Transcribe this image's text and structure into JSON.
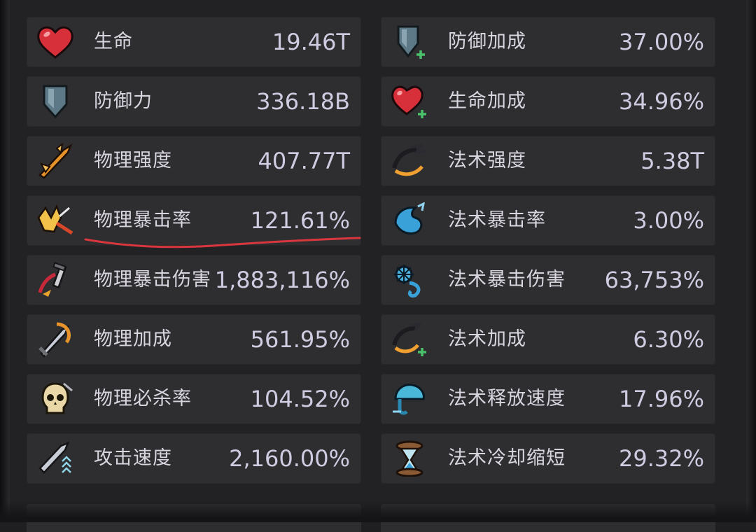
{
  "stats_left": [
    {
      "icon": "heart-icon",
      "label": "生命",
      "value": "19.46T"
    },
    {
      "icon": "shield-icon",
      "label": "防御力",
      "value": "336.18B"
    },
    {
      "icon": "physical-strike-icon",
      "label": "物理强度",
      "value": "407.77T"
    },
    {
      "icon": "physical-crit-icon",
      "label": "物理暴击率",
      "value": "121.61%"
    },
    {
      "icon": "physical-crit-damage-icon",
      "label": "物理暴击伤害",
      "value": "1,883,116%"
    },
    {
      "icon": "sword-bonus-icon",
      "label": "物理加成",
      "value": "561.95%"
    },
    {
      "icon": "skull-icon",
      "label": "物理必杀率",
      "value": "104.52%"
    },
    {
      "icon": "attack-speed-icon",
      "label": "攻击速度",
      "value": "2,160.00%"
    }
  ],
  "stats_right": [
    {
      "icon": "shield-plus-icon",
      "label": "防御加成",
      "value": "37.00%"
    },
    {
      "icon": "heart-plus-icon",
      "label": "生命加成",
      "value": "34.96%"
    },
    {
      "icon": "magic-claw-icon",
      "label": "法术强度",
      "value": "5.38T"
    },
    {
      "icon": "magic-crit-icon",
      "label": "法术暴击率",
      "value": "3.00%"
    },
    {
      "icon": "magic-crit-damage-icon",
      "label": "法术暴击伤害",
      "value": "63,753%"
    },
    {
      "icon": "magic-bonus-icon",
      "label": "法术加成",
      "value": "6.30%"
    },
    {
      "icon": "cast-speed-icon",
      "label": "法术释放速度",
      "value": "17.96%"
    },
    {
      "icon": "hourglass-icon",
      "label": "法术冷却缩短",
      "value": "29.32%"
    }
  ],
  "colors": {
    "row_bg": "#2e2e31",
    "label": "#d9d6e0",
    "value": "#cfcbe0",
    "underline": "#d9363e"
  }
}
